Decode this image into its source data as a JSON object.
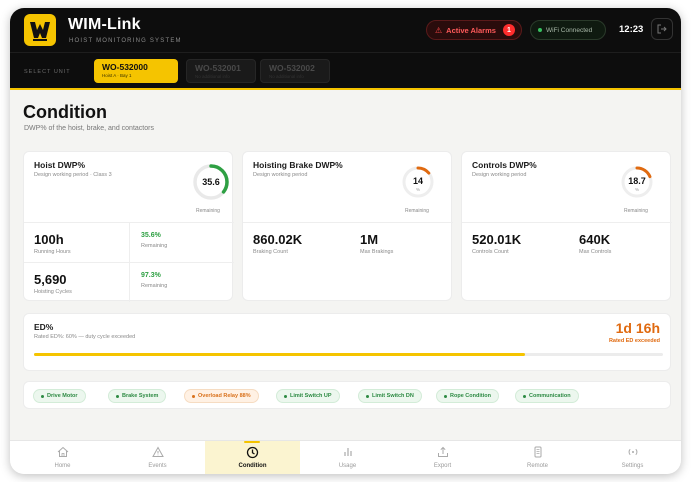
{
  "app": {
    "title": "WIM-Link",
    "subtitle": "HOIST MONITORING SYSTEM",
    "alarm_label": "Active Alarms",
    "alarm_count": "1",
    "wifi_label": "WiFi Connected",
    "time": "12:23"
  },
  "units": {
    "select_label": "SELECT UNIT",
    "tabs": [
      {
        "code": "WO-532000",
        "sub": "Hoist A · Bay 1"
      },
      {
        "code": "WO-532001",
        "sub": "No additional info"
      },
      {
        "code": "WO-532002",
        "sub": "No additional info"
      }
    ]
  },
  "page": {
    "title": "Condition",
    "description": "DWP% of the hoist, brake, and contactors"
  },
  "hoist": {
    "title": "Hoist DWP%",
    "subtitle": "Design working period · Class 3",
    "gauge_value": "35.6",
    "gauge_fraction": 0.356,
    "remaining_label": "Remaining",
    "stat1_value": "100h",
    "stat1_label": "Running Hours",
    "stat1_pct": "35.6%",
    "stat1_pct_label": "Remaining",
    "stat2_value": "5,690",
    "stat2_label": "Hoisting Cycles",
    "stat2_pct": "97.3%",
    "stat2_pct_label": "Remaining"
  },
  "brake": {
    "title": "Hoisting Brake DWP%",
    "subtitle": "Design working period",
    "gauge_value": "14",
    "gauge_unit": "%",
    "gauge_fraction": 0.14,
    "remaining_label": "Remaining",
    "stat1_value": "860.02K",
    "stat1_label": "Braking Count",
    "stat2_value": "1M",
    "stat2_label": "Max Brakings"
  },
  "controls": {
    "title": "Controls DWP%",
    "subtitle": "Design working period",
    "gauge_value": "18.7",
    "gauge_unit": "%",
    "gauge_fraction": 0.187,
    "remaining_label": "Remaining",
    "stat1_value": "520.01K",
    "stat1_label": "Controls Count",
    "stat2_value": "640K",
    "stat2_label": "Max Controls"
  },
  "ed": {
    "title": "ED%",
    "subtitle": "Rated ED%: 60% — duty cycle exceeded",
    "value": "1d 16h",
    "note": "Rated ED exceeded",
    "progress": 0.78
  },
  "chips": [
    {
      "label": "Drive Motor",
      "status": "ok"
    },
    {
      "label": "Brake System",
      "status": "ok"
    },
    {
      "label": "Overload Relay 88%",
      "status": "warn"
    },
    {
      "label": "Limit Switch UP",
      "status": "ok"
    },
    {
      "label": "Limit Switch DN",
      "status": "ok"
    },
    {
      "label": "Rope Condition",
      "status": "ok"
    },
    {
      "label": "Communication",
      "status": "ok"
    }
  ],
  "nav": [
    {
      "label": "Home",
      "icon": "home-icon"
    },
    {
      "label": "Events",
      "icon": "warning-icon"
    },
    {
      "label": "Condition",
      "icon": "clock-icon",
      "active": true
    },
    {
      "label": "Usage",
      "icon": "bar-chart-icon"
    },
    {
      "label": "Export",
      "icon": "export-icon"
    },
    {
      "label": "Remote",
      "icon": "remote-icon"
    },
    {
      "label": "Settings",
      "icon": "settings-icon"
    }
  ],
  "colors": {
    "accent": "#f5c400",
    "header": "#0d0d0d",
    "good": "#2ea043",
    "warning": "#e06a10",
    "alarm": "#ff2d2d"
  }
}
